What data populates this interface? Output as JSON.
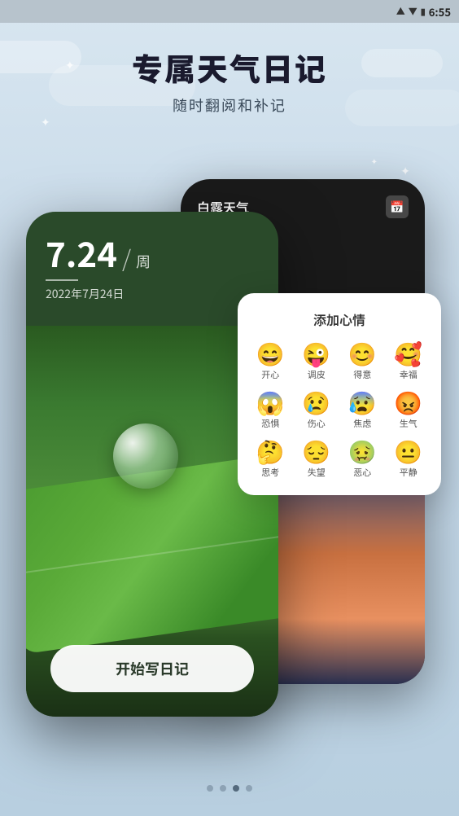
{
  "statusBar": {
    "time": "6:55",
    "signal": "▲",
    "wifi": "WiFi",
    "battery": "🔋"
  },
  "page": {
    "mainTitle": "专属天气日记",
    "subTitle": "随时翻阅和补记"
  },
  "phoneFront": {
    "appName": "白露天气",
    "dateNumber": "7.24",
    "separator": "/",
    "weekLabel": "周",
    "underline": "_",
    "dateFull": "2022年7月24日",
    "startButton": "开始写日记"
  },
  "moodPanel": {
    "title": "添加心情",
    "moods": [
      {
        "emoji": "😄",
        "label": "开心"
      },
      {
        "emoji": "😜",
        "label": "调皮"
      },
      {
        "emoji": "😊",
        "label": "得意"
      },
      {
        "emoji": "🥰",
        "label": "幸福"
      },
      {
        "emoji": "😱",
        "label": "恐惧"
      },
      {
        "emoji": "😢",
        "label": "伤心"
      },
      {
        "emoji": "😰",
        "label": "焦虑"
      },
      {
        "emoji": "😡",
        "label": "生气"
      },
      {
        "emoji": "🤔",
        "label": "思考"
      },
      {
        "emoji": "😔",
        "label": "失望"
      },
      {
        "emoji": "🤢",
        "label": "恶心"
      },
      {
        "emoji": "😐",
        "label": "平静"
      }
    ]
  },
  "pageIndicators": {
    "dots": [
      {
        "active": false
      },
      {
        "active": false
      },
      {
        "active": true
      },
      {
        "active": false
      }
    ]
  },
  "sparkles": [
    "✦",
    "✦",
    "✦",
    "✦"
  ]
}
